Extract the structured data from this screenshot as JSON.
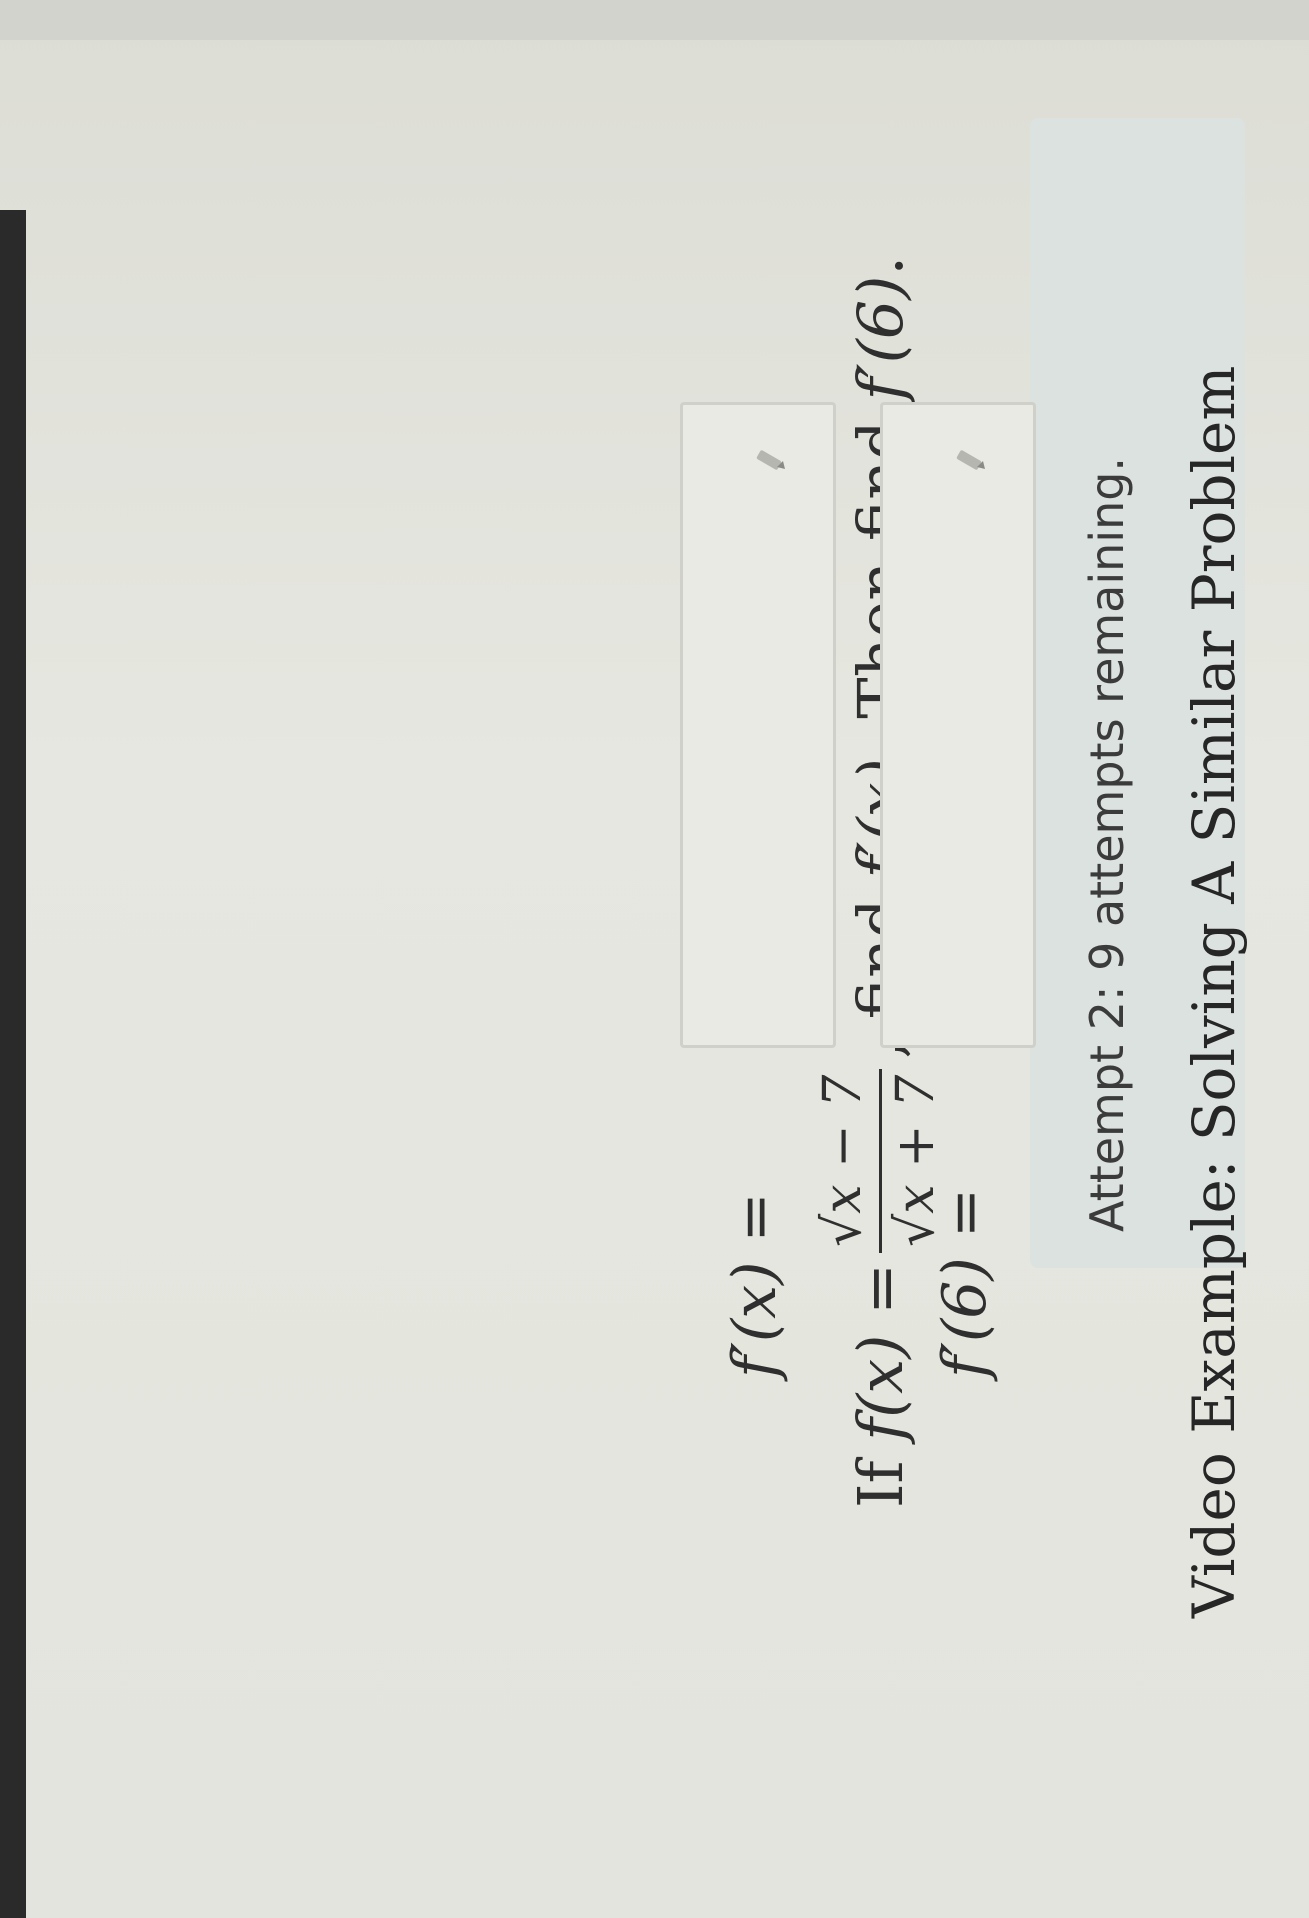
{
  "attempt": {
    "label": "Attempt 2: 9 attempts remaining."
  },
  "question": {
    "if": "If",
    "f_of_x": "f(x)",
    "equals": "=",
    "numerator": "√x − 7",
    "denominator": "√x + 7",
    "mid": ", find",
    "fprime_x": "f′(x)",
    "then": ". Then find",
    "fprime_6": "f′(6)",
    "end": "."
  },
  "answers": [
    {
      "label": "f′(x) =",
      "value": ""
    },
    {
      "label": "f′(6) =",
      "value": ""
    }
  ],
  "video_example": {
    "label": "Video Example: Solving A Similar Problem"
  },
  "icons": {
    "answer_edit": "pencil-icon"
  }
}
